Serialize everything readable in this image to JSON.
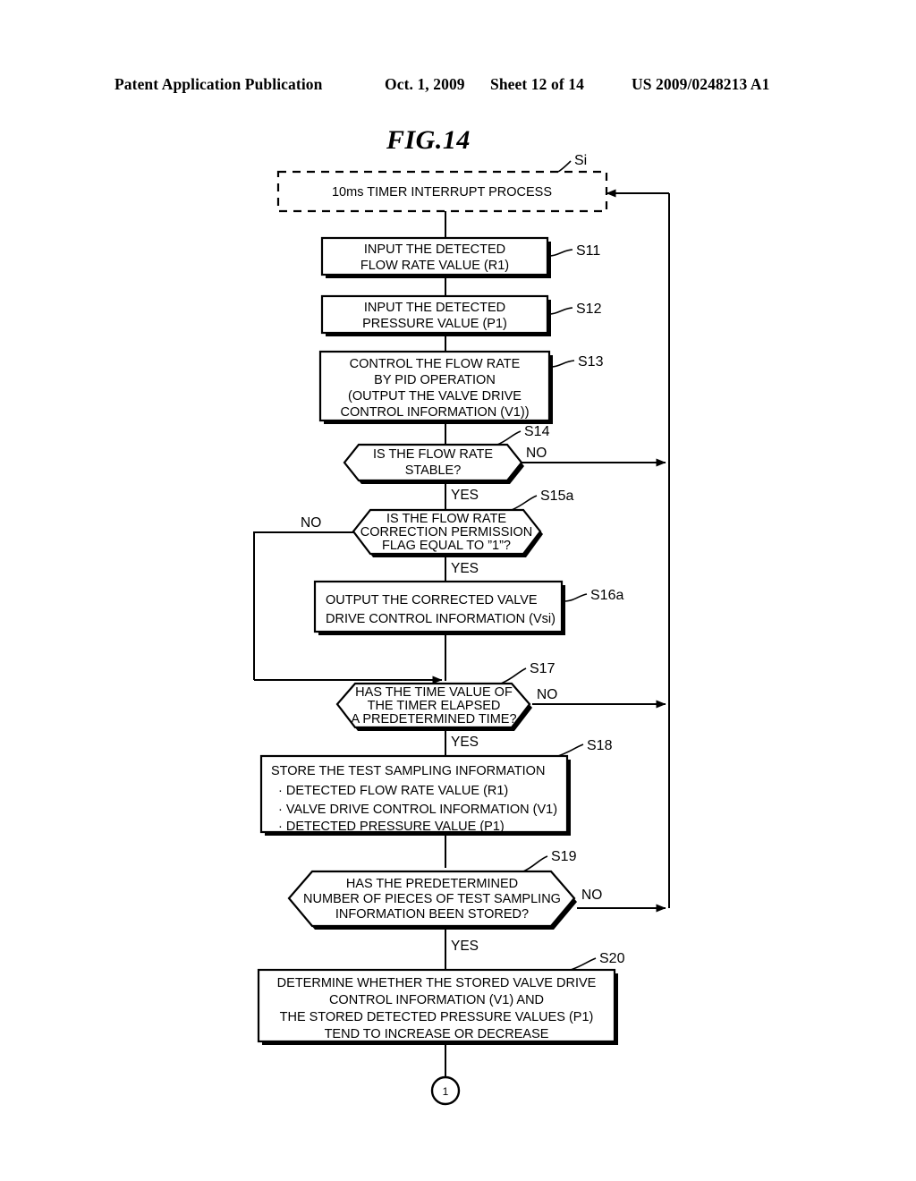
{
  "header": {
    "publication": "Patent Application Publication",
    "date": "Oct. 1, 2009",
    "sheet": "Sheet 12 of 14",
    "number": "US 2009/0248213 A1"
  },
  "figure": {
    "title": "FIG.14"
  },
  "chart_data": {
    "type": "diagram",
    "diagram_type": "flowchart",
    "title": "FIG.14",
    "entry_label": "Si",
    "nodes": [
      {
        "id": "Si",
        "shape": "dashed-rectangle",
        "step": "Si",
        "lines": [
          "10ms TIMER INTERRUPT PROCESS"
        ]
      },
      {
        "id": "S11",
        "shape": "process",
        "step": "S11",
        "lines": [
          "INPUT THE DETECTED",
          "FLOW RATE VALUE (R1)"
        ]
      },
      {
        "id": "S12",
        "shape": "process",
        "step": "S12",
        "lines": [
          "INPUT THE DETECTED",
          "PRESSURE VALUE (P1)"
        ]
      },
      {
        "id": "S13",
        "shape": "process",
        "step": "S13",
        "lines": [
          "CONTROL THE FLOW RATE",
          "BY PID OPERATION",
          "(OUTPUT THE VALVE DRIVE",
          "CONTROL INFORMATION (V1))"
        ]
      },
      {
        "id": "S14",
        "shape": "decision-hexagon",
        "step": "S14",
        "lines": [
          "IS THE FLOW RATE",
          "STABLE?"
        ],
        "branch_right": "NO",
        "branch_bottom": "YES"
      },
      {
        "id": "S15a",
        "shape": "decision-hexagon",
        "step": "S15a",
        "lines": [
          "IS THE FLOW RATE",
          "CORRECTION PERMISSION",
          "FLAG EQUAL TO \"1\"?"
        ],
        "branch_left": "NO",
        "branch_bottom": "YES"
      },
      {
        "id": "S16a",
        "shape": "process",
        "step": "S16a",
        "align": "left",
        "lines": [
          "OUTPUT THE CORRECTED VALVE",
          "DRIVE CONTROL INFORMATION (Vsi)"
        ]
      },
      {
        "id": "S17",
        "shape": "decision-hexagon",
        "step": "S17",
        "lines": [
          "HAS THE TIME VALUE OF",
          "THE TIMER ELAPSED",
          "A PREDETERMINED TIME?"
        ],
        "branch_right": "NO",
        "branch_bottom": "YES"
      },
      {
        "id": "S18",
        "shape": "process",
        "step": "S18",
        "align": "left",
        "lines": [
          "STORE THE TEST SAMPLING INFORMATION",
          "· DETECTED FLOW RATE VALUE (R1)",
          "· VALVE DRIVE CONTROL INFORMATION (V1)",
          "· DETECTED PRESSURE VALUE (P1)"
        ]
      },
      {
        "id": "S19",
        "shape": "decision-hexagon",
        "step": "S19",
        "lines": [
          "HAS THE PREDETERMINED",
          "NUMBER OF PIECES OF TEST SAMPLING",
          "INFORMATION BEEN STORED?"
        ],
        "branch_right": "NO",
        "branch_bottom": "YES"
      },
      {
        "id": "S20",
        "shape": "process",
        "step": "S20",
        "lines": [
          "DETERMINE WHETHER THE STORED VALVE DRIVE",
          "CONTROL INFORMATION (V1) AND",
          "THE STORED DETECTED PRESSURE VALUES (P1)",
          "TEND TO INCREASE OR DECREASE"
        ]
      },
      {
        "id": "connector-1",
        "shape": "circle-connector",
        "lines": [
          "1"
        ]
      }
    ],
    "edges": [
      {
        "from": "Si",
        "to": "S11",
        "label": ""
      },
      {
        "from": "S11",
        "to": "S12",
        "label": ""
      },
      {
        "from": "S12",
        "to": "S13",
        "label": ""
      },
      {
        "from": "S13",
        "to": "S14",
        "label": ""
      },
      {
        "from": "S14",
        "to": "S15a",
        "label": "YES"
      },
      {
        "from": "S14",
        "to": "Si",
        "label": "NO"
      },
      {
        "from": "S15a",
        "to": "S16a",
        "label": "YES"
      },
      {
        "from": "S15a",
        "to": "S17",
        "label": "NO"
      },
      {
        "from": "S16a",
        "to": "S17",
        "label": ""
      },
      {
        "from": "S17",
        "to": "S18",
        "label": "YES"
      },
      {
        "from": "S17",
        "to": "Si",
        "label": "NO"
      },
      {
        "from": "S18",
        "to": "S19",
        "label": ""
      },
      {
        "from": "S19",
        "to": "S20",
        "label": "YES"
      },
      {
        "from": "S19",
        "to": "Si",
        "label": "NO"
      },
      {
        "from": "S20",
        "to": "connector-1",
        "label": ""
      }
    ]
  },
  "flow": {
    "si": {
      "step": "Si",
      "l1": "10ms TIMER INTERRUPT PROCESS"
    },
    "s11": {
      "step": "S11",
      "l1": "INPUT THE DETECTED",
      "l2": "FLOW RATE VALUE (R1)"
    },
    "s12": {
      "step": "S12",
      "l1": "INPUT THE DETECTED",
      "l2": "PRESSURE VALUE (P1)"
    },
    "s13": {
      "step": "S13",
      "l1": "CONTROL THE FLOW RATE",
      "l2": "BY PID OPERATION",
      "l3": "(OUTPUT THE VALVE DRIVE",
      "l4": "CONTROL INFORMATION (V1))"
    },
    "s14": {
      "step": "S14",
      "l1": "IS THE FLOW RATE",
      "l2": "STABLE?",
      "no": "NO",
      "yes": "YES"
    },
    "s15a": {
      "step": "S15a",
      "l1": "IS THE FLOW RATE",
      "l2": "CORRECTION PERMISSION",
      "l3": "FLAG EQUAL TO ”1”?",
      "no": "NO",
      "yes": "YES"
    },
    "s16a": {
      "step": "S16a",
      "l1": "OUTPUT THE CORRECTED VALVE",
      "l2": "DRIVE CONTROL INFORMATION (Vsi)"
    },
    "s17": {
      "step": "S17",
      "l1": "HAS THE TIME VALUE OF",
      "l2": "THE TIMER ELAPSED",
      "l3": "A PREDETERMINED TIME?",
      "no": "NO",
      "yes": "YES"
    },
    "s18": {
      "step": "S18",
      "l1": "STORE THE TEST SAMPLING INFORMATION",
      "l2": "· DETECTED FLOW RATE VALUE (R1)",
      "l3": "· VALVE DRIVE CONTROL INFORMATION (V1)",
      "l4": "· DETECTED PRESSURE VALUE (P1)"
    },
    "s19": {
      "step": "S19",
      "l1": "HAS THE PREDETERMINED",
      "l2": "NUMBER OF PIECES OF TEST SAMPLING",
      "l3": "INFORMATION BEEN STORED?",
      "no": "NO",
      "yes": "YES"
    },
    "s20": {
      "step": "S20",
      "l1": "DETERMINE WHETHER THE STORED VALVE DRIVE",
      "l2": "CONTROL INFORMATION (V1) AND",
      "l3": "THE STORED DETECTED PRESSURE VALUES (P1)",
      "l4": "TEND TO INCREASE OR DECREASE"
    },
    "connector": {
      "label": "1"
    }
  }
}
